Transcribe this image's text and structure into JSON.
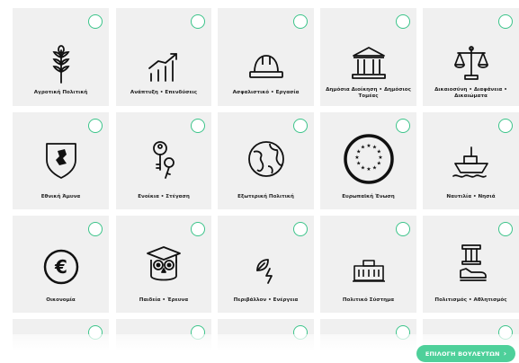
{
  "tiles": [
    {
      "label": "Αγροτική Πολιτική",
      "icon": "wheat-icon"
    },
    {
      "label": "Ανάπτυξη • Επενδύσεις",
      "icon": "growth-chart-icon"
    },
    {
      "label": "Ασφαλιστικό • Εργασία",
      "icon": "hard-hat-icon"
    },
    {
      "label": "Δημόσια Διοίκηση • Δημόσιος Τομέας",
      "icon": "government-building-icon"
    },
    {
      "label": "Δικαιοσύνη • Διαφάνεια • Δικαιώματα",
      "icon": "scales-icon"
    },
    {
      "label": "Εθνική Άμυνα",
      "icon": "shield-icon"
    },
    {
      "label": "Ενοίκια • Στέγαση",
      "icon": "keys-icon"
    },
    {
      "label": "Εξωτερική Πολιτική",
      "icon": "globe-icon"
    },
    {
      "label": "Ευρωπαϊκή Ένωση",
      "icon": "eu-stars-icon"
    },
    {
      "label": "Ναυτιλία • Νησιά",
      "icon": "ship-icon"
    },
    {
      "label": "Οικονομία",
      "icon": "euro-icon"
    },
    {
      "label": "Παιδεία • Έρευνα",
      "icon": "owl-graduate-icon"
    },
    {
      "label": "Περιβάλλον • Ενέργεια",
      "icon": "leaf-energy-icon"
    },
    {
      "label": "Πολιτικό Σύστημα",
      "icon": "parliament-icon"
    },
    {
      "label": "Πολιτισμός • Αθλητισμός",
      "icon": "column-sneaker-icon"
    }
  ],
  "partial_row_count": 5,
  "cta": {
    "label": "ΕΠΙΛΟΓΗ ΒΟΥΛΕΥΤΩΝ",
    "icon": "chevron-right-icon"
  },
  "colors": {
    "accent": "#4ed09a",
    "tile_bg": "#f0f0f0",
    "check_border": "#3cc48a"
  }
}
